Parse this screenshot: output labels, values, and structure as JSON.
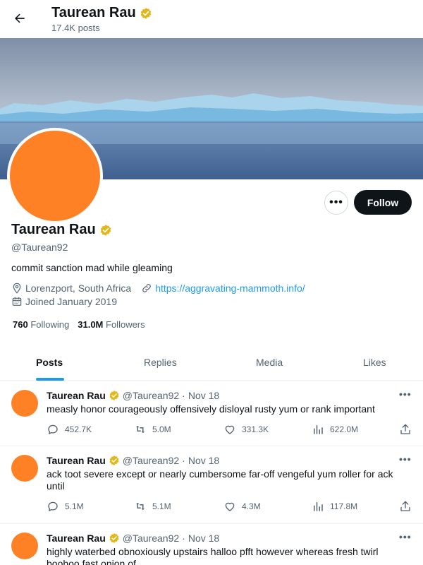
{
  "header": {
    "name": "Taurean Rau",
    "posts_count": "17.4K posts"
  },
  "profile": {
    "name": "Taurean Rau",
    "handle": "@Taurean92",
    "bio": "commit sanction mad while gleaming",
    "location": "Lorenzport, South Africa",
    "website": "https://aggravating-mammoth.info/",
    "joined": "Joined January 2019",
    "following_count": "760",
    "following_label": "Following",
    "followers_count": "31.0M",
    "followers_label": "Followers",
    "follow_label": "Follow",
    "more_label": "•••",
    "avatar_color": "#ff8126"
  },
  "tabs": [
    {
      "label": "Posts",
      "active": true
    },
    {
      "label": "Replies",
      "active": false
    },
    {
      "label": "Media",
      "active": false
    },
    {
      "label": "Likes",
      "active": false
    }
  ],
  "tweets": [
    {
      "name": "Taurean Rau",
      "handle": "@Taurean92",
      "date": "Nov 18",
      "text": "measly honor courageously offensively disloyal rusty yum or rank important",
      "replies": "452.7K",
      "reposts": "5.0M",
      "likes": "331.3K",
      "views": "622.0M"
    },
    {
      "name": "Taurean Rau",
      "handle": "@Taurean92",
      "date": "Nov 18",
      "text": "ack toot severe except or nearly cumbersome far-off vengeful yum roller for ack until",
      "replies": "5.1M",
      "reposts": "5.1M",
      "likes": "4.3M",
      "views": "117.8M"
    },
    {
      "name": "Taurean Rau",
      "handle": "@Taurean92",
      "date": "Nov 18",
      "text": "highly waterbed obnoxiously upstairs halloo pfft however whereas fresh twirl boohoo fast onion of"
    }
  ],
  "colors": {
    "accent": "#1d9bf0",
    "verified": "#e2b719",
    "text": "#0f1419",
    "muted": "#536471"
  }
}
